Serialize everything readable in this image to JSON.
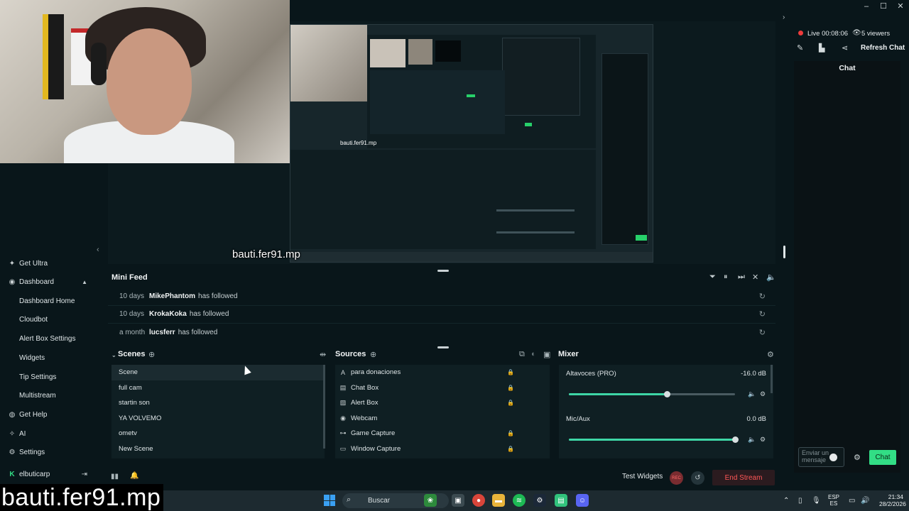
{
  "window": {
    "controls": [
      "–",
      "☐",
      "✕"
    ]
  },
  "preview": {
    "caption": "bauti.fer91.mp",
    "nested_caption": "bauti.fer91.mp"
  },
  "sidebar": {
    "items": [
      {
        "label": "Get Ultra",
        "icon": "ultra-icon",
        "sub": false
      },
      {
        "label": "Dashboard",
        "icon": "dashboard-icon",
        "sub": false
      },
      {
        "label": "Dashboard Home",
        "sub": true
      },
      {
        "label": "Cloudbot",
        "sub": true
      },
      {
        "label": "Alert Box Settings",
        "sub": true
      },
      {
        "label": "Widgets",
        "sub": true
      },
      {
        "label": "Tip Settings",
        "sub": true
      },
      {
        "label": "Multistream",
        "sub": true
      },
      {
        "label": "Get Help",
        "icon": "help-icon",
        "sub": false
      },
      {
        "label": "AI",
        "icon": "ai-icon",
        "sub": false
      },
      {
        "label": "Settings",
        "icon": "gear-icon",
        "sub": false
      },
      {
        "label": "elbuticarp",
        "icon": "kick-icon",
        "sub": false
      }
    ]
  },
  "minifeed": {
    "title": "Mini Feed",
    "rows": [
      {
        "when": "10 days",
        "who": "MikePhantom",
        "action": "has followed"
      },
      {
        "when": "10 days",
        "who": "KrokaKoka",
        "action": "has followed"
      },
      {
        "when": "a month",
        "who": "lucsferr",
        "action": "has followed"
      }
    ]
  },
  "scenes": {
    "title": "Scenes",
    "items": [
      "Scene",
      "full cam",
      "startin son",
      "YA VOLVEMO",
      "ometv",
      "New Scene"
    ],
    "selected": 0
  },
  "sources": {
    "title": "Sources",
    "items": [
      {
        "label": "para donaciones",
        "icon": "text-icon"
      },
      {
        "label": "Chat Box",
        "icon": "chat-icon"
      },
      {
        "label": "Alert Box",
        "icon": "alert-icon"
      },
      {
        "label": "Webcam",
        "icon": "webcam-icon"
      },
      {
        "label": "Game Capture",
        "icon": "gamepad-icon"
      },
      {
        "label": "Window Capture",
        "icon": "window-icon"
      }
    ]
  },
  "mixer": {
    "title": "Mixer",
    "channels": [
      {
        "label": "Altavoces (PRO)",
        "db": "-16.0 dB",
        "level": 0.59
      },
      {
        "label": "Mic/Aux",
        "db": "0.0 dB",
        "level": 1.0
      }
    ]
  },
  "bottom": {
    "test_widgets": "Test Widgets",
    "rec_label": "REC",
    "end_stream": "End Stream"
  },
  "right_panel": {
    "live_text": "Live 00:08:06",
    "viewers": "5 viewers",
    "refresh_chat": "Refresh Chat",
    "chat_title": "Chat",
    "chat_placeholder": "Enviar un mensaje",
    "chat_button": "Chat"
  },
  "taskbar": {
    "search": "Buscar",
    "lang_top": "ESP",
    "lang_bottom": "ES",
    "time": "21:34",
    "date": "28/2/2026"
  },
  "colors": {
    "accent_green": "#32dd85",
    "live_red": "#ee3b3b",
    "end_stream_red": "#ff5757",
    "slider_teal": "#3ed6a6"
  }
}
